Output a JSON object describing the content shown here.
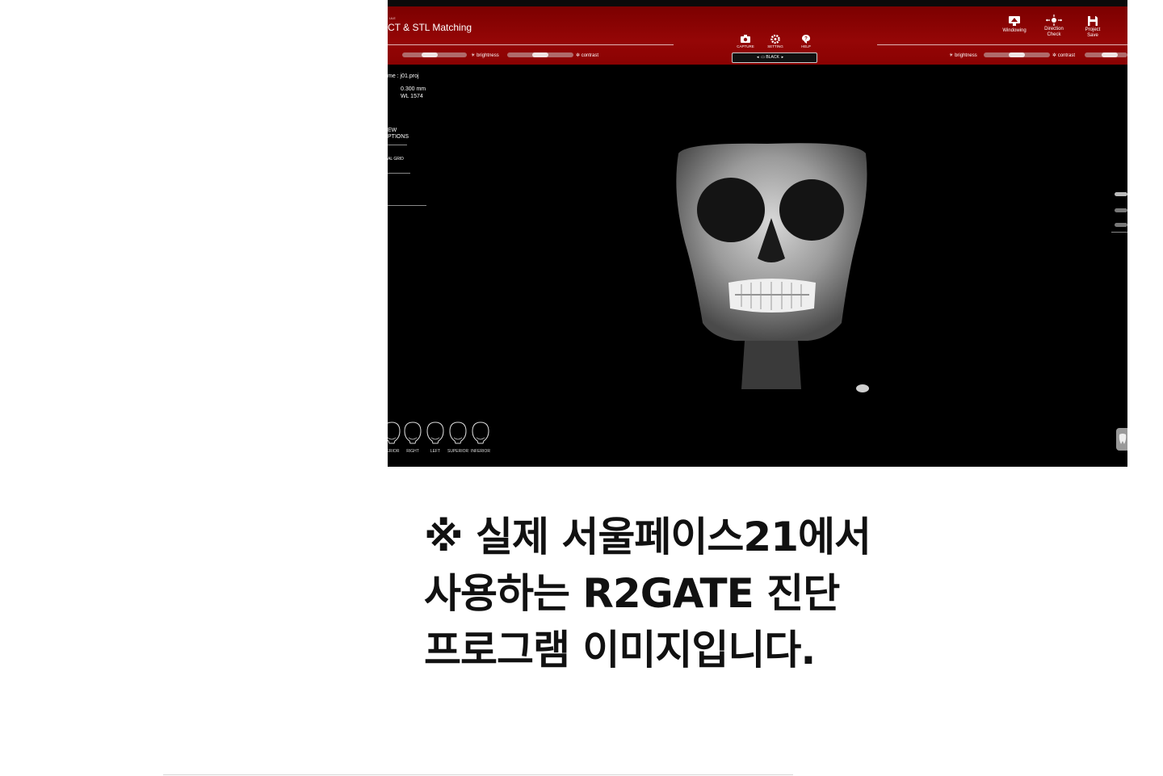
{
  "viewer": {
    "title_prefix": "ULE",
    "title": "CT & STL Matching",
    "left_toolbar": {
      "brightness_label": "brightness",
      "contrast_label": "contrast",
      "brightness_level": 0.4,
      "contrast_level": 0.5
    },
    "center_tools": [
      {
        "label": "CAPTURE",
        "icon": "camera-icon"
      },
      {
        "label": "SETTING",
        "icon": "gear-icon"
      },
      {
        "label": "HELP",
        "icon": "help-icon"
      }
    ],
    "background_select": "BLACK",
    "right_tools": [
      {
        "label_line1": "Windowing",
        "label_line2": "",
        "icon": "windowing-icon"
      },
      {
        "label_line1": "Direction",
        "label_line2": "Check",
        "icon": "direction-icon"
      },
      {
        "label_line1": "Project",
        "label_line2": "Save",
        "icon": "save-icon"
      }
    ],
    "right_toolbar": {
      "brightness_label": "brightness",
      "contrast_label": "contrast",
      "brightness_level": 0.5,
      "contrast_level": 0.65
    },
    "info": {
      "filename": "me : j01.proj",
      "voxel": "0.300 mm",
      "window_level": "WL 1574"
    },
    "options": {
      "view_options_line1": "EW",
      "view_options_line2": "PTIONS",
      "grid_option": "AL GRID"
    },
    "view_directions": [
      "TERIOR",
      "RIGHT",
      "LEFT",
      "SUPERIOR",
      "INFERIOR"
    ],
    "colors": {
      "toolbar_red": "#8b0000",
      "viewport_bg": "#000000"
    }
  },
  "caption": {
    "line1": "※ 실제 서울페이스21에서",
    "line2": "사용하는 R2GATE 진단",
    "line3": "프로그램 이미지입니다."
  }
}
